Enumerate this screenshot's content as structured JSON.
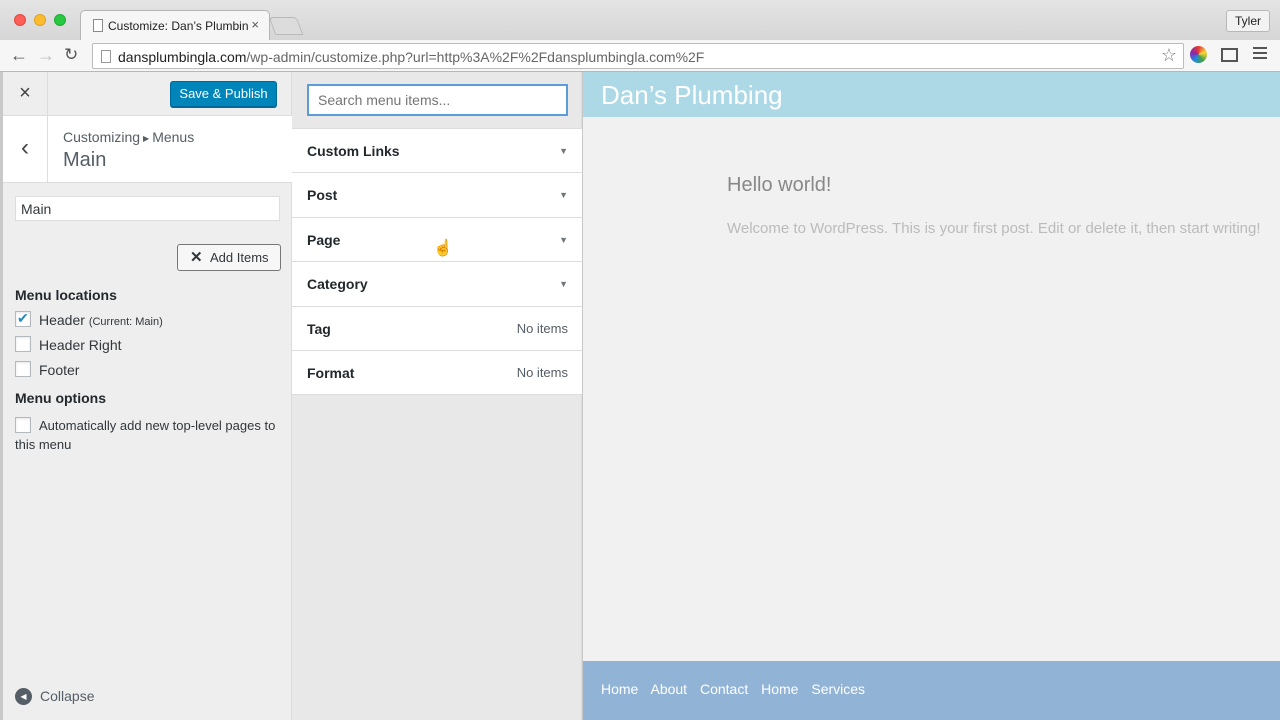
{
  "browser": {
    "tab_title": "Customize: Dan’s Plumbing",
    "tab_close": "×",
    "profile_name": "Tyler",
    "url_host": "dansplumbingla.com",
    "url_path": "/wp-admin/customize.php?url=http%3A%2F%2Fdansplumbingla.com%2F"
  },
  "controls": {
    "close_icon": "×",
    "save_label": "Save & Publish",
    "back_icon": "‹"
  },
  "section": {
    "crumb_parent": "Customizing",
    "crumb_child": "Menus",
    "title": "Main"
  },
  "menu": {
    "name_value": "Main",
    "add_items_label": "Add Items",
    "locations_heading": "Menu locations",
    "locations": [
      {
        "label": "Header",
        "note": "(Current: Main)",
        "checked": true
      },
      {
        "label": "Header Right",
        "note": "",
        "checked": false
      },
      {
        "label": "Footer",
        "note": "",
        "checked": false
      }
    ],
    "options_heading": "Menu options",
    "auto_add_label": "Automatically add new top-level pages to this menu",
    "collapse_label": "Collapse"
  },
  "items_panel": {
    "search_placeholder": "Search menu items...",
    "sections": [
      {
        "label": "Custom Links",
        "status": ""
      },
      {
        "label": "Post",
        "status": ""
      },
      {
        "label": "Page",
        "status": ""
      },
      {
        "label": "Category",
        "status": ""
      },
      {
        "label": "Tag",
        "status": "No items"
      },
      {
        "label": "Format",
        "status": "No items"
      }
    ]
  },
  "preview": {
    "site_title": "Dan’s Plumbing",
    "post_title": "Hello world!",
    "post_excerpt": "Welcome to WordPress. This is your first post. Edit or delete it, then start writing!",
    "footer_links": [
      "Home",
      "About",
      "Contact",
      "Home",
      "Services"
    ]
  },
  "colors": {
    "primary_button": "#0085ba",
    "site_header": "#add8e6",
    "site_footer": "#91b3d6"
  }
}
